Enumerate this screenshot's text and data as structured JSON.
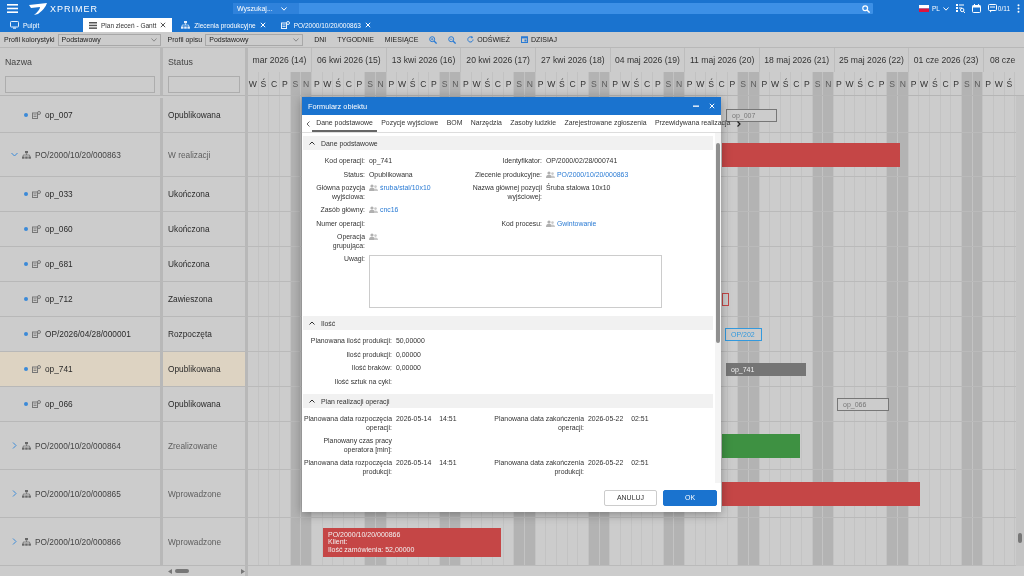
{
  "app": {
    "logo": "XPRIMER",
    "search_scope": "Wyszukaj...",
    "language": "PL",
    "notifications": "0/11"
  },
  "tabs": [
    {
      "label": "Pulpit",
      "kind": "home",
      "selected": false,
      "closable": false
    },
    {
      "label": "Plan zleceń - Gantt",
      "kind": "gantt",
      "selected": true,
      "closable": true
    },
    {
      "label": "Zlecenia produkcyjne",
      "kind": "orders",
      "selected": false,
      "closable": true
    },
    {
      "label": "PO/2000/10/20/000863",
      "kind": "order",
      "selected": false,
      "closable": true
    }
  ],
  "toolbar": {
    "selects": [
      {
        "label": "Profil kolorystyki",
        "value": "Podstawowy"
      },
      {
        "label": "Profil opisu",
        "value": "Podstawowy"
      }
    ],
    "buttons": [
      {
        "label": "DNI",
        "kind": "text"
      },
      {
        "label": "TYGODNIE",
        "kind": "text"
      },
      {
        "label": "MIESIĄCE",
        "kind": "text"
      },
      {
        "kind": "zoom-in"
      },
      {
        "kind": "zoom-out"
      },
      {
        "label": "ODŚWIEŻ",
        "kind": "refresh"
      },
      {
        "label": "DZISIAJ",
        "kind": "today"
      }
    ]
  },
  "grid": {
    "columns": [
      {
        "label": "Nazwa"
      },
      {
        "label": "Status"
      }
    ],
    "weeks": [
      {
        "label": "mar 2026 (14)",
        "days": [
          {
            "label": "W",
            "weekend": false
          },
          {
            "label": "Ś",
            "weekend": false
          },
          {
            "label": "C",
            "weekend": false
          },
          {
            "label": "P",
            "weekend": false
          },
          {
            "label": "S",
            "weekend": true
          },
          {
            "label": "N",
            "weekend": true
          }
        ]
      },
      {
        "label": "06 kwi 2026 (15)",
        "days": [
          {
            "label": "P",
            "weekend": false
          },
          {
            "label": "W",
            "weekend": false
          },
          {
            "label": "Ś",
            "weekend": false
          },
          {
            "label": "C",
            "weekend": false
          },
          {
            "label": "P",
            "weekend": false
          },
          {
            "label": "S",
            "weekend": true
          },
          {
            "label": "N",
            "weekend": true
          }
        ]
      },
      {
        "label": "13 kwi 2026 (16)",
        "days": [
          {
            "label": "P",
            "weekend": false
          },
          {
            "label": "W",
            "weekend": false
          },
          {
            "label": "Ś",
            "weekend": false
          },
          {
            "label": "C",
            "weekend": false
          },
          {
            "label": "P",
            "weekend": false
          },
          {
            "label": "S",
            "weekend": true
          },
          {
            "label": "N",
            "weekend": true
          }
        ]
      },
      {
        "label": "20 kwi 2026 (17)",
        "days": [
          {
            "label": "P",
            "weekend": false
          },
          {
            "label": "W",
            "weekend": false
          },
          {
            "label": "Ś",
            "weekend": false
          },
          {
            "label": "C",
            "weekend": false
          },
          {
            "label": "P",
            "weekend": false
          },
          {
            "label": "S",
            "weekend": true
          },
          {
            "label": "N",
            "weekend": true
          }
        ]
      },
      {
        "label": "27 kwi 2026 (18)",
        "days": [
          {
            "label": "P",
            "weekend": false
          },
          {
            "label": "W",
            "weekend": false
          },
          {
            "label": "Ś",
            "weekend": false
          },
          {
            "label": "C",
            "weekend": false
          },
          {
            "label": "P",
            "weekend": false
          },
          {
            "label": "S",
            "weekend": true
          },
          {
            "label": "N",
            "weekend": true
          }
        ]
      },
      {
        "label": "04 maj 2026 (19)",
        "days": [
          {
            "label": "P",
            "weekend": false
          },
          {
            "label": "W",
            "weekend": false
          },
          {
            "label": "Ś",
            "weekend": false
          },
          {
            "label": "C",
            "weekend": false
          },
          {
            "label": "P",
            "weekend": false
          },
          {
            "label": "S",
            "weekend": true
          },
          {
            "label": "N",
            "weekend": true
          }
        ]
      },
      {
        "label": "11 maj 2026 (20)",
        "days": [
          {
            "label": "P",
            "weekend": false
          },
          {
            "label": "W",
            "weekend": false
          },
          {
            "label": "Ś",
            "weekend": false
          },
          {
            "label": "C",
            "weekend": false
          },
          {
            "label": "P",
            "weekend": false
          },
          {
            "label": "S",
            "weekend": true
          },
          {
            "label": "N",
            "weekend": true
          }
        ]
      },
      {
        "label": "18 maj 2026 (21)",
        "days": [
          {
            "label": "P",
            "weekend": false
          },
          {
            "label": "W",
            "weekend": false
          },
          {
            "label": "Ś",
            "weekend": false
          },
          {
            "label": "C",
            "weekend": false
          },
          {
            "label": "P",
            "weekend": false
          },
          {
            "label": "S",
            "weekend": true
          },
          {
            "label": "N",
            "weekend": true
          }
        ]
      },
      {
        "label": "25 maj 2026 (22)",
        "days": [
          {
            "label": "P",
            "weekend": false
          },
          {
            "label": "W",
            "weekend": false
          },
          {
            "label": "Ś",
            "weekend": false
          },
          {
            "label": "C",
            "weekend": false
          },
          {
            "label": "P",
            "weekend": false
          },
          {
            "label": "S",
            "weekend": true
          },
          {
            "label": "N",
            "weekend": true
          }
        ]
      },
      {
        "label": "01 cze 2026 (23)",
        "days": [
          {
            "label": "P",
            "weekend": false
          },
          {
            "label": "W",
            "weekend": false
          },
          {
            "label": "Ś",
            "weekend": false
          },
          {
            "label": "C",
            "weekend": false
          },
          {
            "label": "P",
            "weekend": false
          },
          {
            "label": "S",
            "weekend": true
          },
          {
            "label": "N",
            "weekend": true
          }
        ]
      },
      {
        "label": "08 cze",
        "days": [
          {
            "label": "P",
            "weekend": false
          },
          {
            "label": "W",
            "weekend": false
          },
          {
            "label": "Ś",
            "weekend": false
          }
        ]
      }
    ],
    "rows": [
      {
        "label": "op_007",
        "status": "Opublikowana",
        "kind": "operation",
        "selected": false,
        "bar": {
          "kind": "outline",
          "color": "#777777",
          "lines": [
            "op_007"
          ]
        }
      },
      {
        "label": "PO/2000/10/20/000863",
        "status": "W realizacji",
        "kind": "order",
        "expanded": true,
        "selected": false,
        "bar": {
          "kind": "filled",
          "color": "#c54646"
        },
        "children": [
          {
            "label": "op_033",
            "status": "Ukończona",
            "kind": "operation",
            "selected": false
          },
          {
            "label": "op_060",
            "status": "Ukończona",
            "kind": "operation",
            "selected": false
          },
          {
            "label": "op_681",
            "status": "Ukończona",
            "kind": "operation",
            "selected": false
          },
          {
            "label": "op_712",
            "status": "Zawieszona",
            "kind": "operation",
            "selected": false,
            "bar": {
              "kind": "outline",
              "color": "#c54646"
            }
          },
          {
            "label": "OP/2026/04/28/000001",
            "status": "Rozpoczęta",
            "kind": "operation",
            "selected": false,
            "bar": {
              "kind": "outline",
              "color": "#3399dd",
              "lines": [
                "OP/202"
              ]
            }
          },
          {
            "label": "op_741",
            "status": "Opublikowana",
            "kind": "operation",
            "selected": true,
            "bar": {
              "kind": "filled",
              "color": "#757575",
              "lines": [
                "op_741"
              ]
            }
          },
          {
            "label": "op_066",
            "status": "Opublikowana",
            "kind": "operation",
            "selected": false,
            "bar": {
              "kind": "outline",
              "color": "#777777",
              "lines": [
                "op_066"
              ]
            }
          }
        ]
      },
      {
        "label": "PO/2000/10/20/000864",
        "status": "Zrealizowane",
        "kind": "order",
        "expanded": false,
        "selected": false,
        "bar": {
          "kind": "filled",
          "color": "#3e9142"
        }
      },
      {
        "label": "PO/2000/10/20/000865",
        "status": "Wprowadzone",
        "kind": "order",
        "expanded": false,
        "selected": false,
        "bar": {
          "kind": "filled",
          "color": "#c54646"
        }
      },
      {
        "label": "PO/2000/10/20/000866",
        "status": "Wprowadzone",
        "kind": "order",
        "expanded": false,
        "selected": false,
        "bar": {
          "kind": "filled",
          "color": "#c54646",
          "lines": [
            "PO/2000/10/20/000866",
            "Klient:",
            "Ilość zamówienia: 52,00000"
          ]
        }
      }
    ]
  },
  "dialog": {
    "title": "Formularz obiektu",
    "tabs": [
      {
        "label": "Dane podstawowe",
        "selected": true
      },
      {
        "label": "Pozycje wyjściowe",
        "selected": false
      },
      {
        "label": "BOM",
        "selected": false
      },
      {
        "label": "Narzędzia",
        "selected": false
      },
      {
        "label": "Zasoby ludzkie",
        "selected": false
      },
      {
        "label": "Zarejestrowane zgłoszenia",
        "selected": false
      },
      {
        "label": "Przewidywana realizacja",
        "selected": false
      }
    ],
    "sections": [
      {
        "title": "Dane podstawowe",
        "expanded": true,
        "rows": [
          [
            {
              "label": "Kod operacji:",
              "kind": "text",
              "value": "op_741"
            },
            {
              "label": "Identyfikator:",
              "kind": "text",
              "value": "OP/2000/02/28/000741"
            }
          ],
          [
            {
              "label": "Status:",
              "kind": "text",
              "value": "Opublikowana"
            },
            {
              "label": "Zlecenie produkcyjne:",
              "kind": "link",
              "value": "PO/2000/10/20/000863"
            }
          ],
          [
            {
              "label": "Główna pozycja wyjściowa:",
              "kind": "link",
              "value": "śruba/stal/10x10"
            },
            {
              "label": "Nazwa głównej pozycji wyjściowej:",
              "kind": "text",
              "value": "Śruba stalowa 10x10"
            }
          ],
          [
            {
              "label": "Zasób główny:",
              "kind": "link",
              "value": "cnc16"
            }
          ],
          [
            {
              "label": "Numer operacji:",
              "kind": "text"
            },
            {
              "label": "Kod procesu:",
              "kind": "link",
              "value": "Gwintowanie"
            }
          ],
          [
            {
              "label": "Operacja grupująca:",
              "kind": "link"
            }
          ],
          [
            {
              "label": "Uwagi:",
              "kind": "textarea"
            }
          ]
        ]
      },
      {
        "title": "Ilość",
        "expanded": true,
        "rows": [
          [
            {
              "label": "Planowana ilość produkcji:",
              "kind": "text",
              "value": "50,00000"
            }
          ],
          [
            {
              "label": "Ilość produkcji:",
              "kind": "text",
              "value": "0,00000"
            }
          ],
          [
            {
              "label": "Ilość braków:",
              "kind": "text",
              "value": "0,00000"
            }
          ],
          [
            {
              "label": "Ilość sztuk na cykl:",
              "kind": "text"
            }
          ]
        ]
      },
      {
        "title": "Plan realizacji operacji",
        "expanded": true,
        "rows": [
          [
            {
              "label": "Planowana data rozpoczęcia operacji:",
              "kind": "text",
              "value": "2026-05-14",
              "time": "14:51"
            },
            {
              "label": "Planowana data zakończenia operacji:",
              "kind": "text",
              "value": "2026-05-22",
              "time": "02:51"
            }
          ],
          [
            {
              "label": "Planowany czas pracy operatora [min]:",
              "kind": "text"
            }
          ],
          [
            {
              "label": "Planowana data rozpoczęcia produkcji:",
              "kind": "text",
              "value": "2026-05-14",
              "time": "14:51"
            },
            {
              "label": "Planowana data zakończenia produkcji:",
              "kind": "text",
              "value": "2026-05-22",
              "time": "02:51"
            }
          ]
        ]
      }
    ],
    "buttons": [
      {
        "label": "ANULUJ",
        "kind": "secondary"
      },
      {
        "label": "OK",
        "kind": "primary"
      }
    ]
  }
}
